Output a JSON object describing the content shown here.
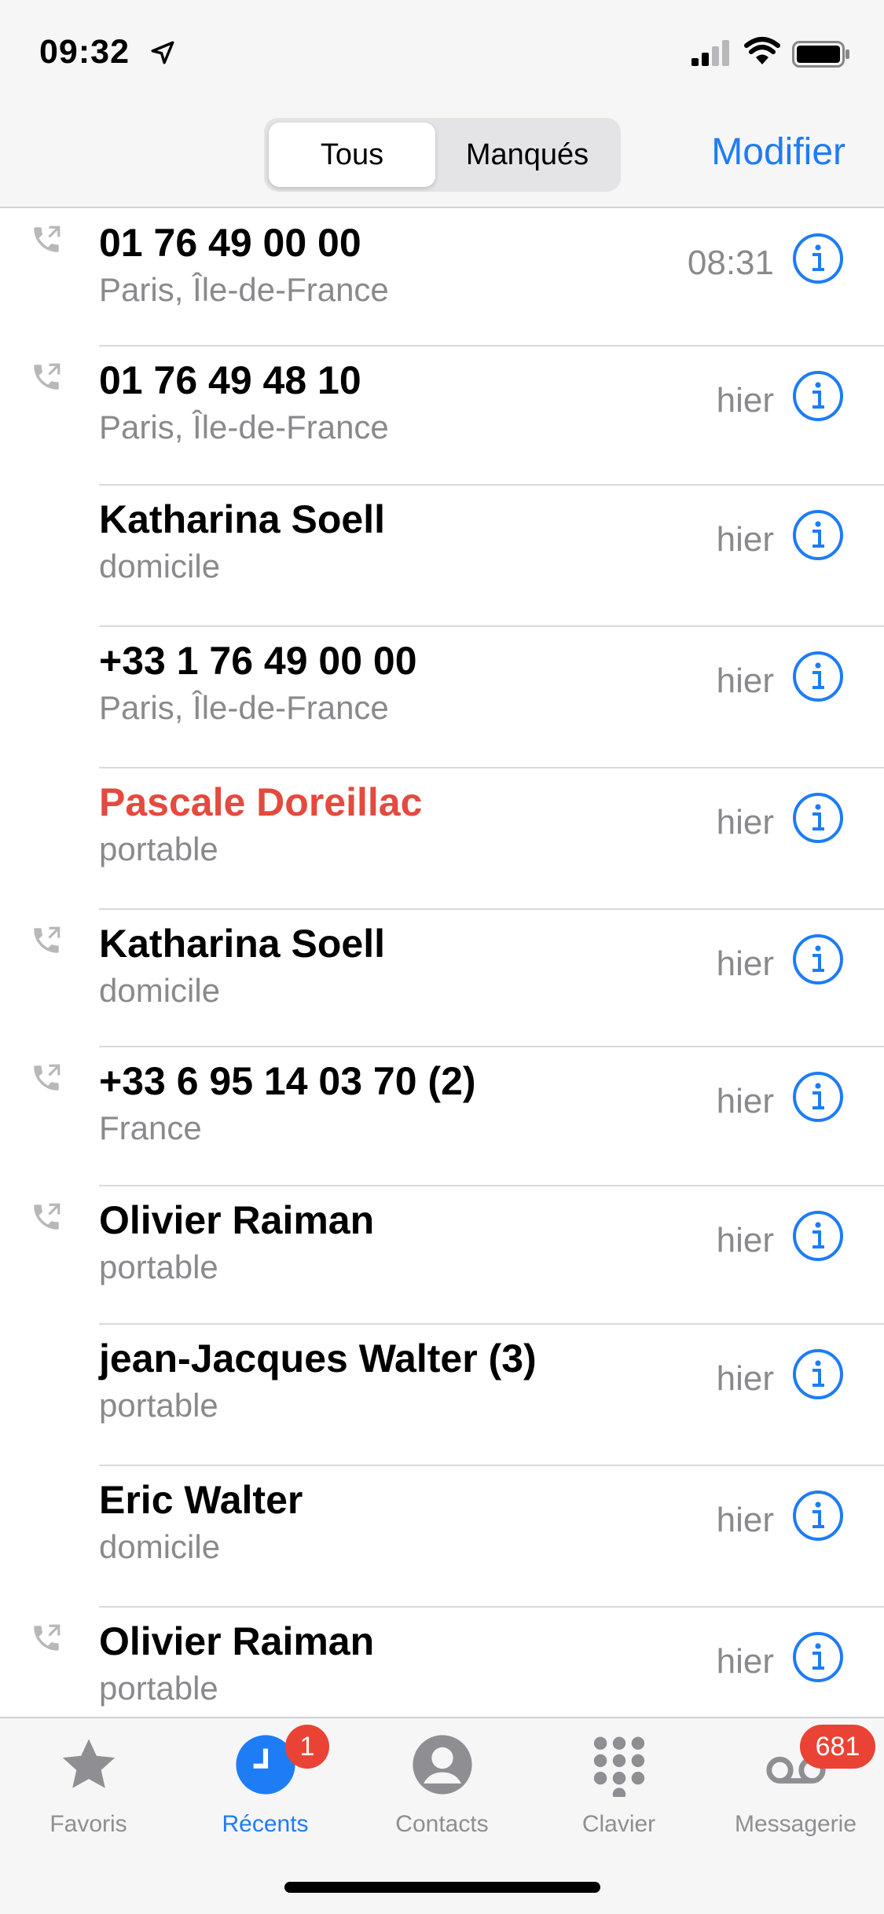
{
  "status_bar": {
    "time": "09:32"
  },
  "segmented": {
    "all_label": "Tous",
    "missed_label": "Manqués"
  },
  "header": {
    "edit_label": "Modifier"
  },
  "calls": [
    {
      "name": "01 76 49 00 00",
      "subtitle": "Paris, Île-de-France",
      "when": "08:31",
      "missed": false,
      "outgoing": true
    },
    {
      "name": "01 76 49 48 10",
      "subtitle": "Paris, Île-de-France",
      "when": "hier",
      "missed": false,
      "outgoing": true
    },
    {
      "name": "Katharina Soell",
      "subtitle": "domicile",
      "when": "hier",
      "missed": false,
      "outgoing": false
    },
    {
      "name": "+33 1 76 49 00 00",
      "subtitle": "Paris, Île-de-France",
      "when": "hier",
      "missed": false,
      "outgoing": false
    },
    {
      "name": "Pascale Doreillac",
      "subtitle": "portable",
      "when": "hier",
      "missed": true,
      "outgoing": false
    },
    {
      "name": "Katharina Soell",
      "subtitle": "domicile",
      "when": "hier",
      "missed": false,
      "outgoing": true
    },
    {
      "name": "+33 6 95 14 03 70 (2)",
      "subtitle": "France",
      "when": "hier",
      "missed": false,
      "outgoing": true
    },
    {
      "name": "Olivier Raiman",
      "subtitle": "portable",
      "when": "hier",
      "missed": false,
      "outgoing": true
    },
    {
      "name": "jean-Jacques Walter (3)",
      "subtitle": "portable",
      "when": "hier",
      "missed": false,
      "outgoing": false
    },
    {
      "name": "Eric Walter",
      "subtitle": "domicile",
      "when": "hier",
      "missed": false,
      "outgoing": false
    },
    {
      "name": "Olivier Raiman",
      "subtitle": "portable",
      "when": "hier",
      "missed": false,
      "outgoing": true
    }
  ],
  "tabs": [
    {
      "label": "Favoris",
      "icon": "star-icon",
      "active": false
    },
    {
      "label": "Récents",
      "icon": "clock-icon",
      "active": true,
      "badge": "1"
    },
    {
      "label": "Contacts",
      "icon": "person-icon",
      "active": false
    },
    {
      "label": "Clavier",
      "icon": "keypad-icon",
      "active": false
    },
    {
      "label": "Messagerie",
      "icon": "voicemail-icon",
      "active": false,
      "badge": "681"
    }
  ],
  "colors": {
    "accent": "#1e7cf5",
    "missed": "#e44a3e",
    "secondary_text": "#8a8a8e",
    "badge": "#ea4335"
  }
}
